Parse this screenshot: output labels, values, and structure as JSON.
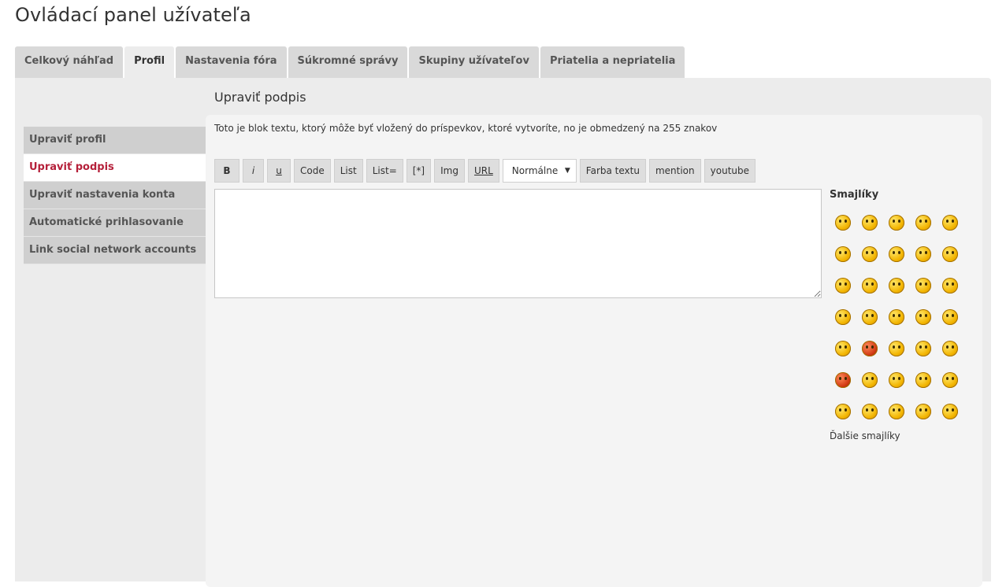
{
  "page": {
    "title": "Ovládací panel užívateľa"
  },
  "tabs": [
    {
      "label": "Celkový náhľad"
    },
    {
      "label": "Profil"
    },
    {
      "label": "Nastavenia fóra"
    },
    {
      "label": "Súkromné správy"
    },
    {
      "label": "Skupiny užívateľov"
    },
    {
      "label": "Priatelia a nepriatelia"
    }
  ],
  "sidebar": {
    "items": [
      {
        "label": "Upraviť profil"
      },
      {
        "label": "Upraviť podpis"
      },
      {
        "label": "Upraviť nastavenia konta"
      },
      {
        "label": "Automatické prihlasovanie"
      },
      {
        "label": "Link social network accounts"
      }
    ]
  },
  "main": {
    "section_title": "Upraviť podpis",
    "description": "Toto je blok textu, ktorý môže byť vložený do príspevkov, ktoré vytvoríte, no je obmedzený na 255 znakov",
    "signature_value": ""
  },
  "toolbar": {
    "bold": "B",
    "italic": "i",
    "underline": "u",
    "code": "Code",
    "list": "List",
    "list_eq": "List=",
    "list_item": "[*]",
    "img": "Img",
    "url": "URL",
    "font_size_selected": "Normálne",
    "color": "Farba textu",
    "mention": "mention",
    "youtube": "youtube"
  },
  "smilies": {
    "title": "Smajlíky",
    "more": "Ďalšie smajlíky",
    "count": 35
  }
}
